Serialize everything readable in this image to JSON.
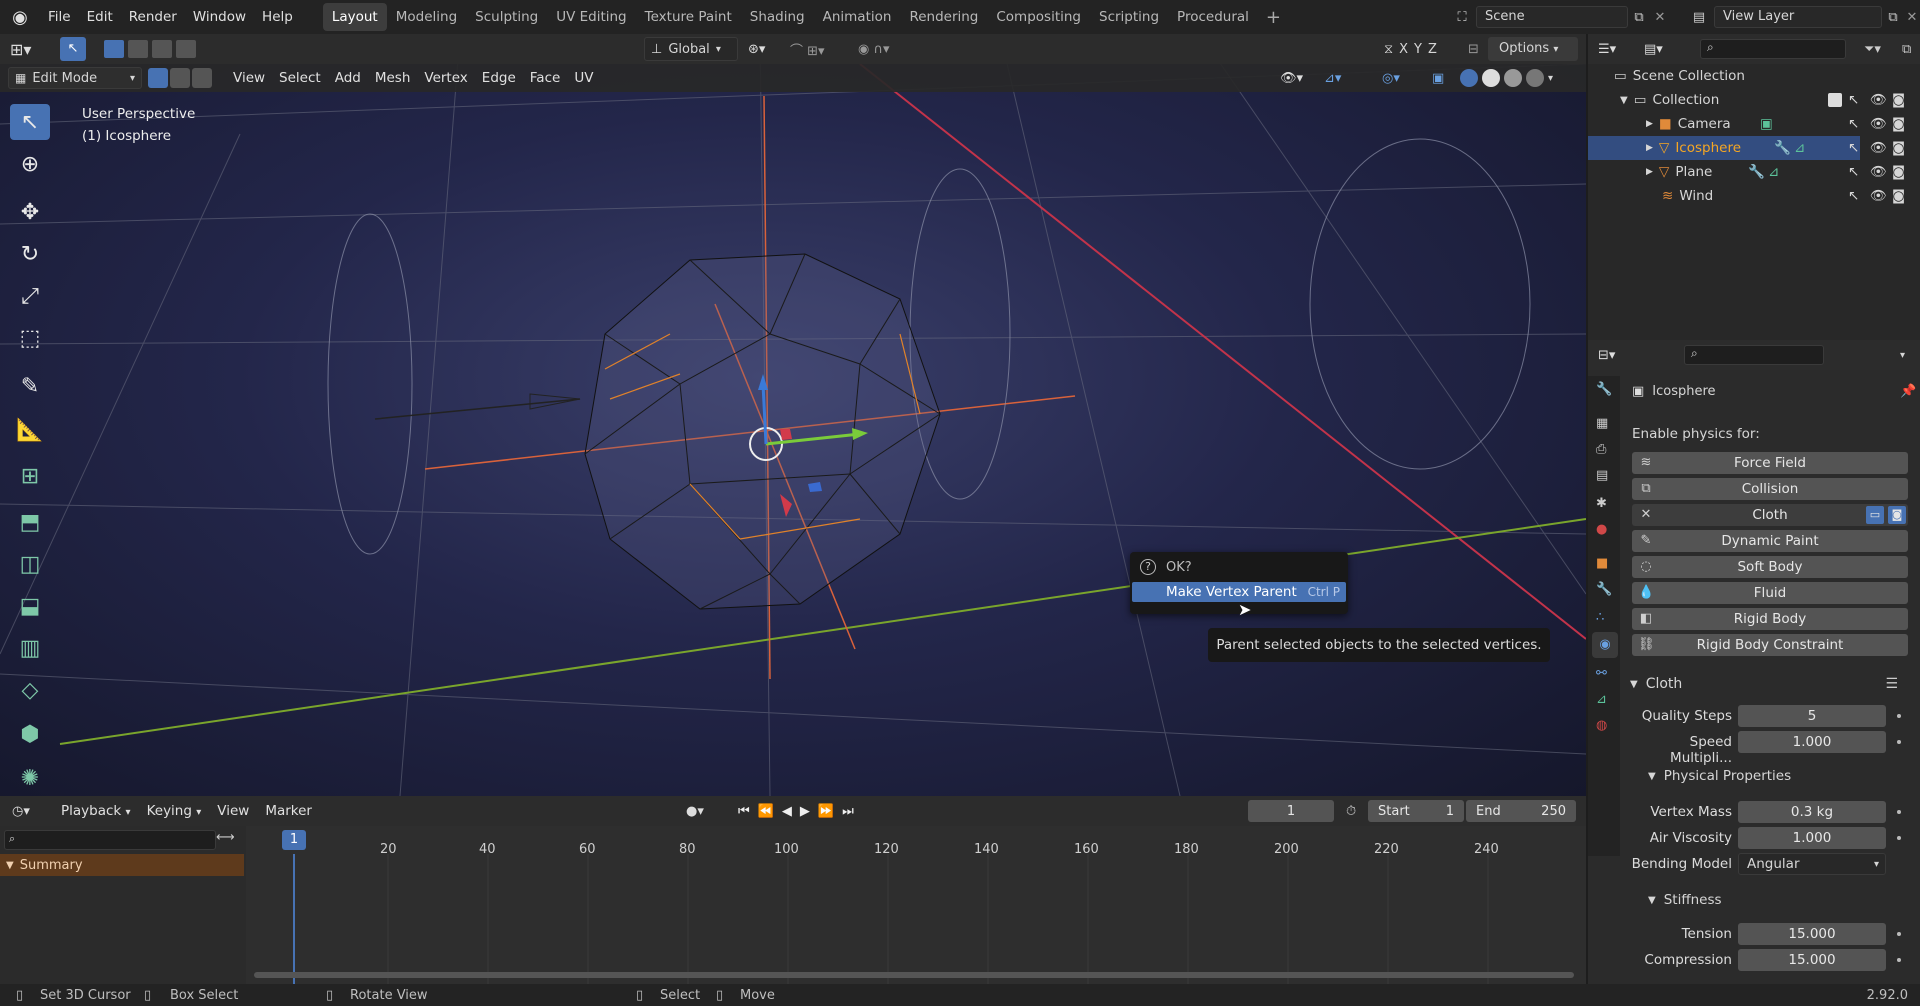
{
  "topbar": {
    "menus": [
      "File",
      "Edit",
      "Render",
      "Window",
      "Help"
    ],
    "workspaces": [
      "Layout",
      "Modeling",
      "Sculpting",
      "UV Editing",
      "Texture Paint",
      "Shading",
      "Animation",
      "Rendering",
      "Compositing",
      "Scripting",
      "Procedural"
    ],
    "active_workspace": "Layout",
    "scene": "Scene",
    "view_layer": "View Layer"
  },
  "viewport_header": {
    "mode": "Edit Mode",
    "menus": [
      "View",
      "Select",
      "Add",
      "Mesh",
      "Vertex",
      "Edge",
      "Face",
      "UV"
    ],
    "orientation": "Global",
    "axes": [
      "X",
      "Y",
      "Z"
    ],
    "options": "Options"
  },
  "viewport": {
    "perspective": "User Perspective",
    "object": "(1) Icosphere"
  },
  "popup": {
    "title": "OK?",
    "item": "Make Vertex Parent",
    "shortcut": "Ctrl P",
    "tooltip": "Parent selected objects to the selected vertices."
  },
  "outliner": {
    "root": "Scene Collection",
    "collection": "Collection",
    "items": [
      "Camera",
      "Icosphere",
      "Plane",
      "Wind"
    ],
    "selected": "Icosphere"
  },
  "properties": {
    "object": "Icosphere",
    "enable_label": "Enable physics for:",
    "physics": [
      "Force Field",
      "Collision",
      "Cloth",
      "Dynamic Paint",
      "Soft Body",
      "Fluid",
      "Rigid Body",
      "Rigid Body Constraint"
    ],
    "cloth_panel": "Cloth",
    "quality_steps_label": "Quality Steps",
    "quality_steps": "5",
    "speed_label": "Speed Multipli...",
    "speed": "1.000",
    "physical_panel": "Physical Properties",
    "vertex_mass_label": "Vertex Mass",
    "vertex_mass": "0.3 kg",
    "air_viscosity_label": "Air Viscosity",
    "air_viscosity": "1.000",
    "bending_label": "Bending Model",
    "bending": "Angular",
    "stiffness_panel": "Stiffness",
    "tension_label": "Tension",
    "tension": "15.000",
    "compression_label": "Compression",
    "compression": "15.000"
  },
  "timeline": {
    "menus": [
      "Playback",
      "Keying",
      "View",
      "Marker"
    ],
    "current_frame": "1",
    "start_label": "Start",
    "start": "1",
    "end_label": "End",
    "end": "250",
    "ticks": [
      "20",
      "40",
      "60",
      "80",
      "100",
      "120",
      "140",
      "160",
      "180",
      "200",
      "220",
      "240"
    ],
    "summary": "Summary",
    "playhead": "1"
  },
  "statusbar": {
    "items": [
      "Set 3D Cursor",
      "Box Select",
      "Rotate View",
      "Select",
      "Move"
    ],
    "version": "2.92.0"
  },
  "colors": {
    "accent": "#4772b3",
    "selected_object": "#f5a623",
    "background": "#1d1d1d"
  }
}
